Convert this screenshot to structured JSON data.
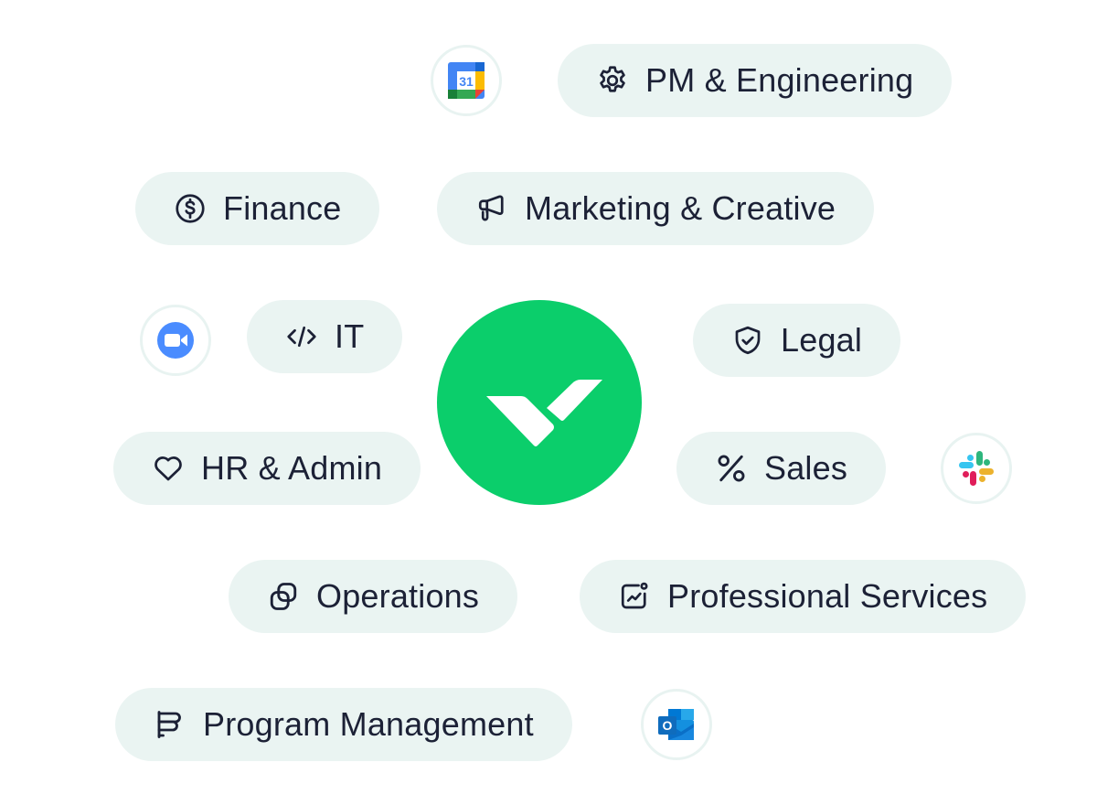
{
  "brand": {
    "name": "Wrike",
    "logo_icon": "wrike-checkmark-logo",
    "color": "#0bce6b"
  },
  "theme": {
    "pill_background": "#eaf4f2",
    "text_color": "#1c2136",
    "app_ring_color": "#e8f3f1"
  },
  "departments": [
    {
      "label": "PM & Engineering",
      "icon": "gear-icon"
    },
    {
      "label": "Finance",
      "icon": "dollar-coin-icon"
    },
    {
      "label": "Marketing & Creative",
      "icon": "megaphone-icon"
    },
    {
      "label": "IT",
      "icon": "code-icon"
    },
    {
      "label": "Legal",
      "icon": "shield-check-icon"
    },
    {
      "label": "HR & Admin",
      "icon": "heart-icon"
    },
    {
      "label": "Sales",
      "icon": "percent-icon"
    },
    {
      "label": "Operations",
      "icon": "linked-squares-icon"
    },
    {
      "label": "Professional Services",
      "icon": "chart-badge-icon"
    },
    {
      "label": "Program Management",
      "icon": "gantt-icon"
    }
  ],
  "integrations": [
    {
      "name": "Google Calendar",
      "icon": "google-calendar-icon",
      "text": "31"
    },
    {
      "name": "Zoom",
      "icon": "zoom-icon"
    },
    {
      "name": "Slack",
      "icon": "slack-icon"
    },
    {
      "name": "Outlook",
      "icon": "outlook-icon",
      "text": "O"
    }
  ]
}
